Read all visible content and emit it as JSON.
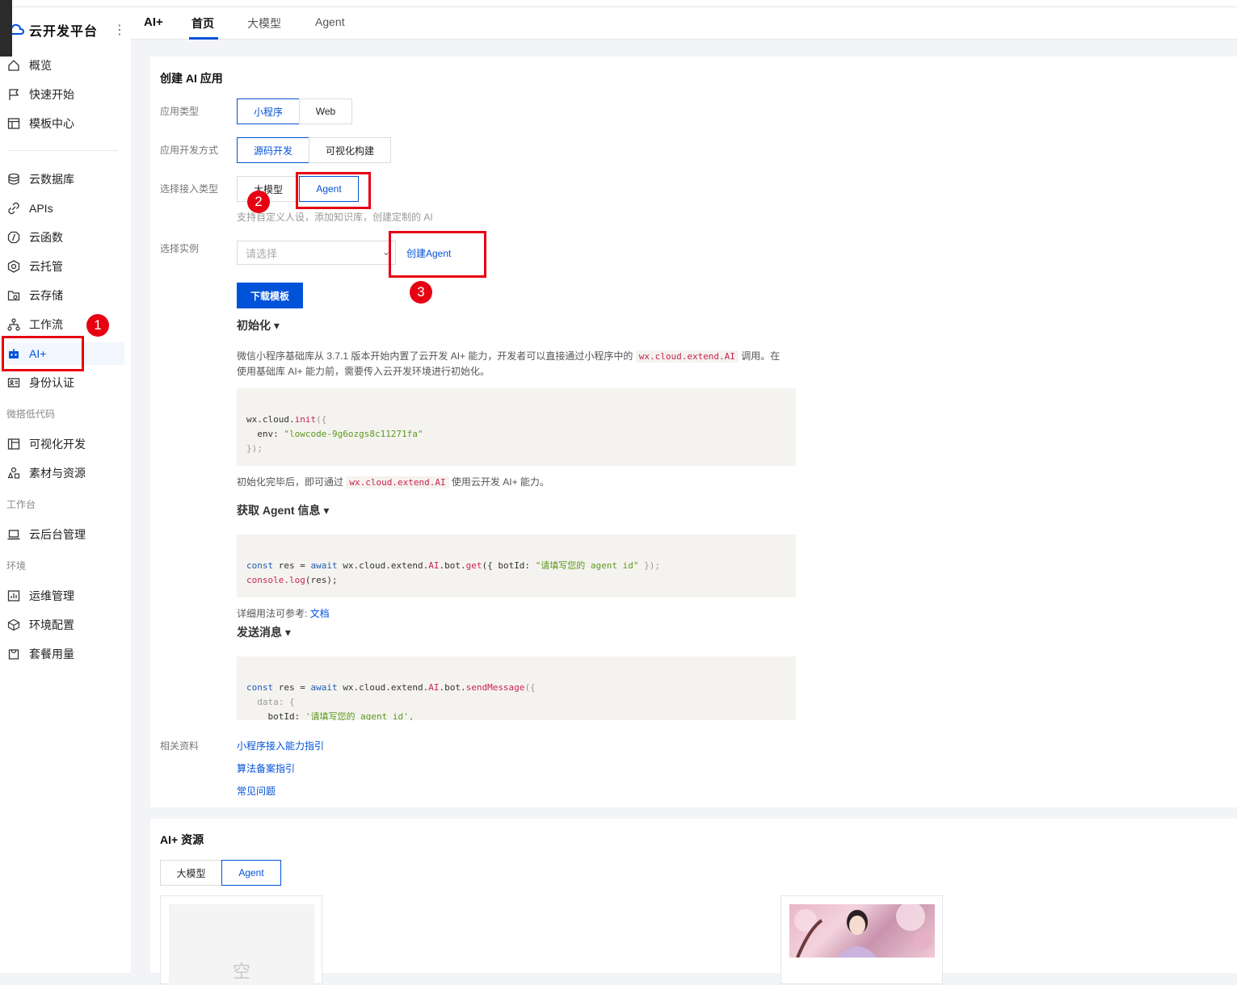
{
  "brand": {
    "name": "云开发平台",
    "more_icon": "more-vertical-icon"
  },
  "sidebar": {
    "items": [
      {
        "label": "概览",
        "icon": "home-icon"
      },
      {
        "label": "快速开始",
        "icon": "flag-icon"
      },
      {
        "label": "模板中心",
        "icon": "template-icon"
      },
      {
        "label": "云数据库",
        "icon": "database-icon"
      },
      {
        "label": "APIs",
        "icon": "link-icon"
      },
      {
        "label": "云函数",
        "icon": "function-icon"
      },
      {
        "label": "云托管",
        "icon": "hexagon-icon"
      },
      {
        "label": "云存储",
        "icon": "folder-icon"
      },
      {
        "label": "工作流",
        "icon": "workflow-icon"
      },
      {
        "label": "AI+",
        "icon": "robot-icon"
      },
      {
        "label": "身份认证",
        "icon": "idcard-icon"
      },
      {
        "label": "可视化开发",
        "icon": "layout-icon"
      },
      {
        "label": "素材与资源",
        "icon": "shapes-icon"
      },
      {
        "label": "云后台管理",
        "icon": "laptop-icon"
      },
      {
        "label": "运维管理",
        "icon": "chart-icon"
      },
      {
        "label": "环境配置",
        "icon": "cube-icon"
      },
      {
        "label": "套餐用量",
        "icon": "bag-icon"
      }
    ],
    "groups": [
      "微搭低代码",
      "工作台",
      "环境"
    ]
  },
  "tabs": {
    "title": "AI+",
    "items": [
      "首页",
      "大模型",
      "Agent"
    ]
  },
  "create": {
    "title": "创建 AI 应用",
    "app_type_label": "应用类型",
    "app_type_options": [
      "小程序",
      "Web"
    ],
    "dev_mode_label": "应用开发方式",
    "dev_mode_options": [
      "源码开发",
      "可视化构建"
    ],
    "access_type_label": "选择接入类型",
    "access_type_options": [
      "大模型",
      "Agent"
    ],
    "access_hint": "支持自定义人设，添加知识库，创建定制的 AI",
    "instance_label": "选择实例",
    "instance_placeholder": "请选择",
    "create_agent": "创建Agent",
    "download_button": "下载模板",
    "init_head": "初始化 ▾",
    "init_para_a": "微信小程序基础库从 3.7.1 版本开始内置了云开发 AI+ 能力，开发者可以直接通过小程序中的",
    "init_para_code": "wx.cloud.extend.AI",
    "init_para_b": "调用。在使用基础库 AI+ 能力前，需要传入云开发环境进行初始化。",
    "init_code": {
      "l1_a": "wx.cloud.",
      "l1_fn": "init",
      "l1_b": "({",
      "l2_a": "  env: ",
      "l2_str": "\"lowcode-9g6ozgs8c11271fa\"",
      "l3": "});"
    },
    "after_init_a": "初始化完毕后，即可通过",
    "after_init_code": "wx.cloud.extend.AI",
    "after_init_b": "使用云开发 AI+ 能力。",
    "get_head": "获取 Agent 信息 ▾",
    "get_code": {
      "l1_kw": "const",
      "l1_a": " res = ",
      "l1_kw2": "await",
      "l1_b": " wx.cloud.extend.",
      "l1_ai": "AI",
      "l1_c": ".bot.",
      "l1_fn": "get",
      "l1_d": "({ botId: ",
      "l1_str": "\"请填写您的 agent id\"",
      "l1_e": " });",
      "l2_fn": "console.log",
      "l2_b": "(res);"
    },
    "doc_ref": "详细用法可参考: ",
    "doc_link": "文档",
    "send_head": "发送消息 ▾",
    "send_code": {
      "l1_kw": "const",
      "l1_a": " res = ",
      "l1_kw2": "await",
      "l1_b": " wx.cloud.extend.",
      "l1_ai": "AI",
      "l1_c": ".bot.",
      "l1_fn": "sendMessage",
      "l1_d": "({",
      "l2": "  data: {",
      "l3_a": "    botId: ",
      "l3_str": "'请填写您的 agent id',"
    },
    "related_label": "相关资料",
    "related_links": [
      "小程序接入能力指引",
      "算法备案指引",
      "常见问题"
    ]
  },
  "resources": {
    "title": "AI+ 资源",
    "tabs": [
      "大模型",
      "Agent"
    ],
    "empty_text": "空"
  },
  "annotations": [
    "1",
    "2",
    "3"
  ],
  "colors": {
    "accent": "#0052d9",
    "annotation": "#e60012"
  }
}
